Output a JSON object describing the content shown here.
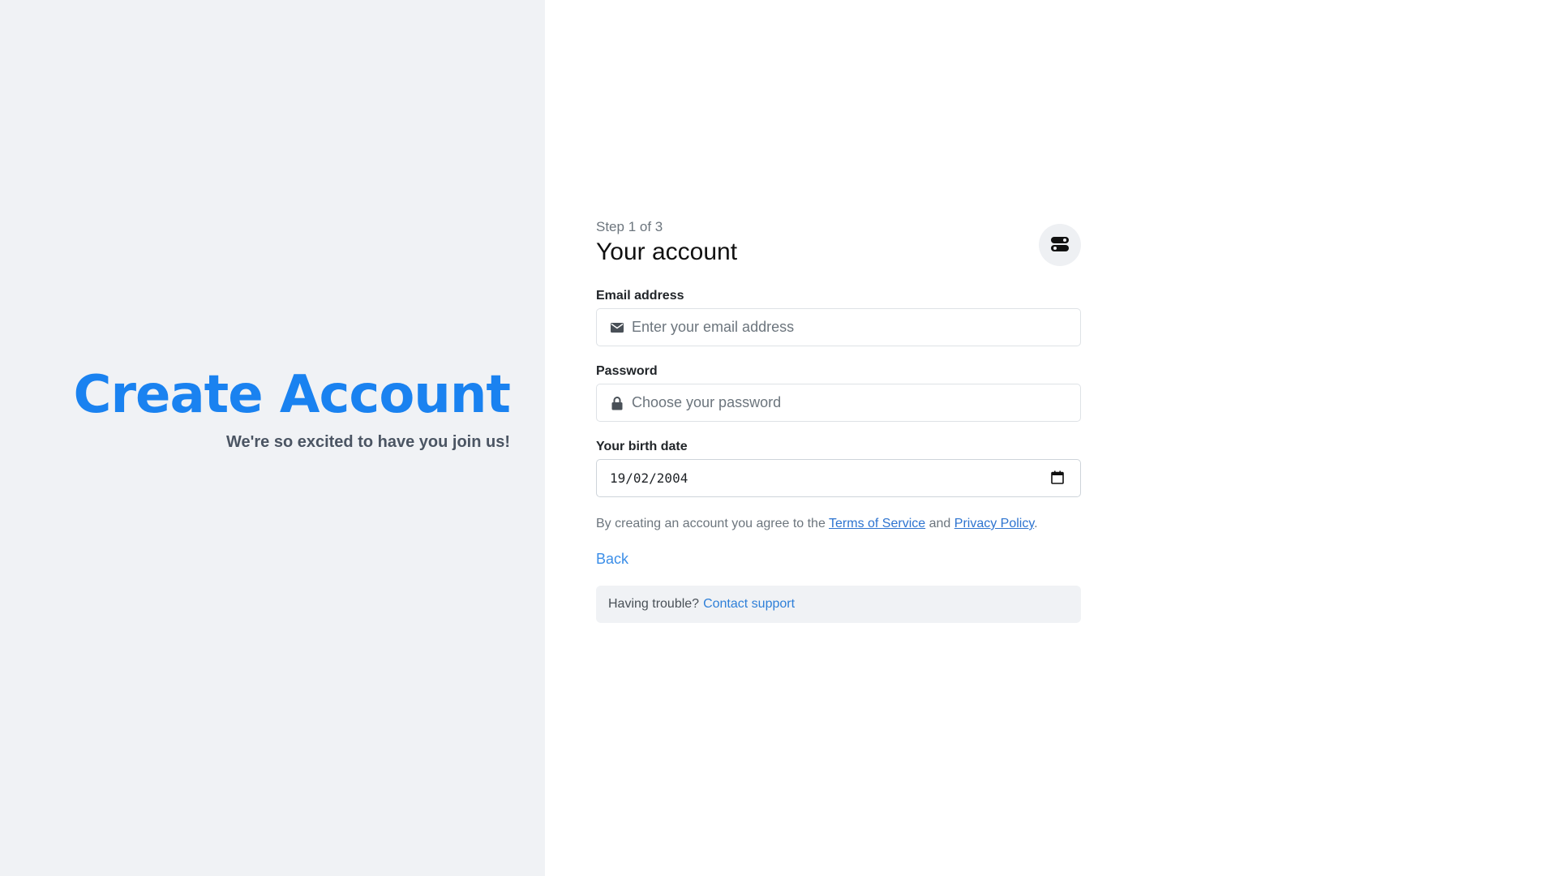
{
  "hero": {
    "title": "Create Account",
    "subtitle": "We're so excited to have you join us!"
  },
  "form": {
    "step": "Step 1 of 3",
    "title": "Your account",
    "theme_toggle_icon": "toggle-icon",
    "email": {
      "label": "Email address",
      "placeholder": "Enter your email address",
      "icon": "envelope-icon"
    },
    "password": {
      "label": "Password",
      "placeholder": "Choose your password",
      "icon": "lock-icon"
    },
    "birthdate": {
      "label": "Your birth date",
      "value": "19/02/2004",
      "icon": "calendar-icon"
    },
    "terms": {
      "prefix": "By creating an account you agree to the",
      "tos": "Terms of Service",
      "and": "and",
      "privacy": "Privacy Policy",
      "suffix": "."
    },
    "back_label": "Back",
    "support": {
      "text": "Having trouble?",
      "link": "Contact support"
    }
  },
  "colors": {
    "accent": "#1a82f0",
    "left_bg": "#f0f2f5",
    "link": "#2e74d0"
  }
}
